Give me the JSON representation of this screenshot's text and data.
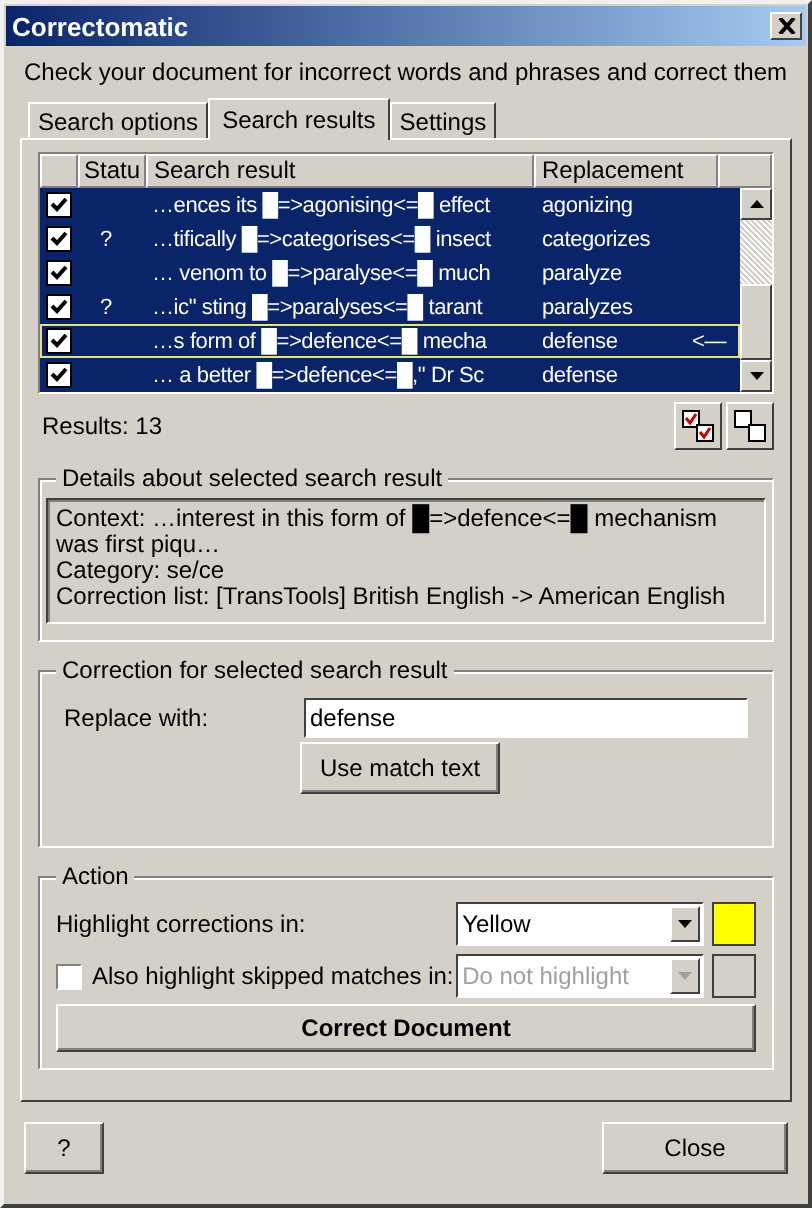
{
  "window": {
    "title": "Correctomatic"
  },
  "intro": "Check your document for incorrect words and phrases and correct them",
  "tabs": [
    {
      "label": "Search options",
      "selected": false
    },
    {
      "label": "Search results",
      "selected": true
    },
    {
      "label": "Settings",
      "selected": false
    }
  ],
  "results_table": {
    "columns": [
      "Statu",
      "Search result",
      "Replacement"
    ],
    "rows": [
      {
        "checked": true,
        "selected": true,
        "focused": false,
        "search_result": "…ences its █=>agonising<=█ effect",
        "replacement": "agonizing"
      },
      {
        "checked": true,
        "selected": true,
        "focused": false,
        "status": "?",
        "search_result": "…tifically █=>categorises<=█ insect",
        "replacement": "categorizes"
      },
      {
        "checked": true,
        "selected": true,
        "focused": false,
        "search_result": "… venom to █=>paralyse<=█ much",
        "replacement": "paralyze"
      },
      {
        "checked": true,
        "selected": true,
        "focused": false,
        "status": "?",
        "search_result": "…ic\" sting █=>paralyses<=█ tarant",
        "replacement": "paralyzes"
      },
      {
        "checked": true,
        "selected": true,
        "focused": true,
        "search_result": "…s form of █=>defence<=█ mecha",
        "replacement": "defense",
        "marker": "<—"
      },
      {
        "checked": true,
        "selected": true,
        "focused": false,
        "search_result": "… a better █=>defence<=█,\" Dr Sc",
        "replacement": "defense"
      }
    ]
  },
  "results_count": "Results: 13",
  "details": {
    "title": "Details about selected search result",
    "lines": [
      "Context: …interest in this form of █=>defence<=█ mechanism was first piqu…",
      "Category: se/ce",
      "Correction list: [TransTools] British English -> American English"
    ]
  },
  "correction": {
    "title": "Correction for selected search result",
    "label": "Replace with:",
    "value": "defense",
    "button": "Use match text"
  },
  "action": {
    "title": "Action",
    "highlight": {
      "label": "Highlight corrections in:",
      "value": "Yellow",
      "color": "#ffff00",
      "disabled": false
    },
    "skipped": {
      "label": "Also highlight skipped matches in:",
      "checked": false,
      "value": "Do not highlight",
      "disabled": true
    },
    "button": "Correct Document"
  },
  "footer_buttons": [
    "?",
    "Close"
  ]
}
